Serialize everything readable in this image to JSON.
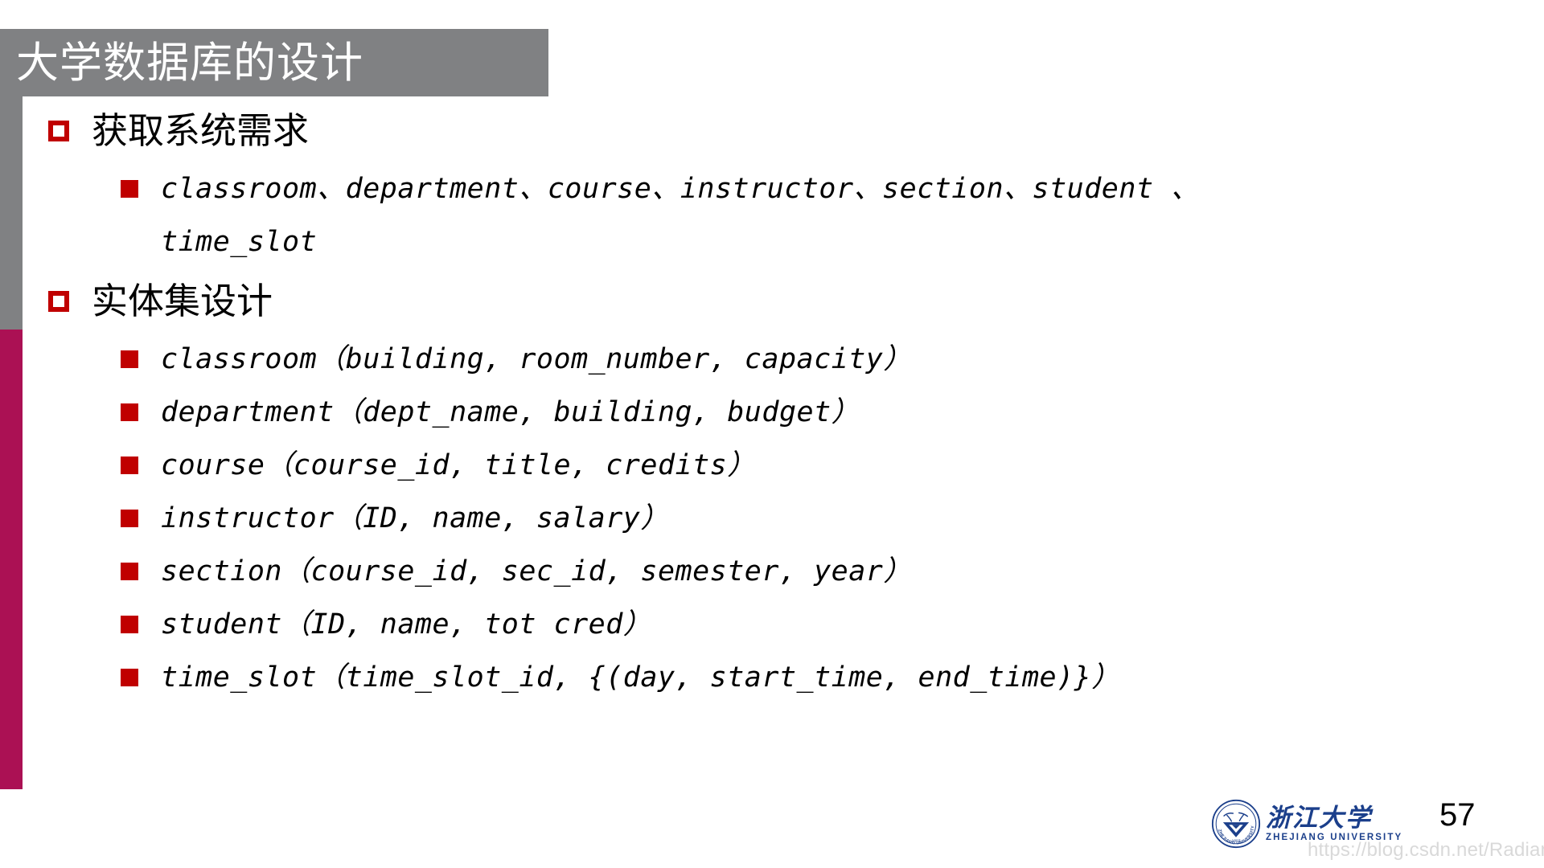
{
  "slide": {
    "title": "大学数据库的设计",
    "page_number": "57",
    "watermark": "https://blog.csdn.net/RadiantJeral",
    "colors": {
      "banner_gray": "#808183",
      "sidebar_crimson": "#AB1154",
      "bullet_red": "#C00000",
      "logo_blue": "#1B3F8B",
      "watermark_gray": "#D9D9D9",
      "title_text": "#FFFFFF",
      "body_text": "#000000"
    },
    "sections": [
      {
        "heading": "获取系统需求",
        "bullet": "hollow-red-square",
        "items": [
          "classroom、department、course、instructor、section、student 、",
          "time_slot"
        ]
      },
      {
        "heading": "实体集设计",
        "bullet": "hollow-red-square",
        "items": [
          "classroom（building, room_number, capacity）",
          "department（dept_name, building, budget）",
          "course（course_id, title, credits）",
          "instructor（ID, name, salary）",
          "section（course_id, sec_id, semester, year）",
          "student（ID, name, tot cred）",
          "time_slot（time_slot_id, {(day, start_time, end_time)}）"
        ]
      }
    ],
    "logo": {
      "cn_name": "浙江大学",
      "en_name": "ZHEJIANG UNIVERSITY",
      "seal_year": "1897"
    }
  }
}
